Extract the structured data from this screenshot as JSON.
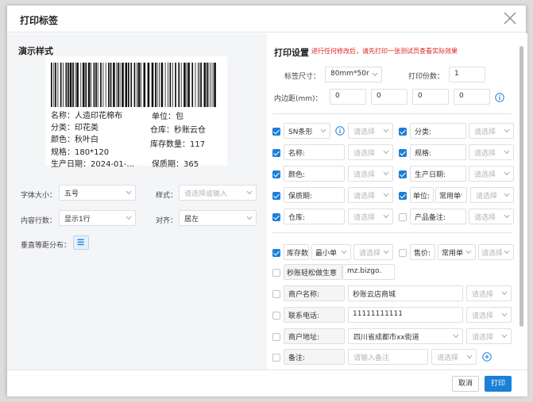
{
  "dialog": {
    "title": "打印标签",
    "cancel": "取消",
    "print": "打印"
  },
  "preview": {
    "title": "演示样式",
    "label": {
      "name": "名称：人造印花棉布",
      "unit": "单位：包",
      "category": "分类：印花类",
      "warehouse": "仓库：秒账云仓",
      "color": "颜色：秋叶白",
      "stock": "库存数量：117",
      "spec": "规格：180*120",
      "date": "生产日期：2024-01-...",
      "shelf": "保质期：365"
    },
    "font_size_label": "字体大小：",
    "font_size_value": "五号",
    "style_label": "样式：",
    "style_placeholder": "请选择或输入",
    "lines_label": "内容行数：",
    "lines_value": "显示1行",
    "align_label": "对齐：",
    "align_value": "居左",
    "vertical_label": "垂直等距分布："
  },
  "settings": {
    "title": "打印设置",
    "hint": "进行任何修改后，请先打印一张测试页查看实际效果",
    "size_label": "标签尺寸：",
    "size_value": "80mm*50r",
    "copies_label": "打印份数：",
    "copies_value": "1",
    "padding_label": "内边距(mm)：",
    "padding_values": [
      "0",
      "0",
      "0",
      "0"
    ],
    "select_placeholder": "请选择",
    "note_placeholder": "请输入备注",
    "fields": {
      "sn": "SN条形",
      "category": "分类:",
      "name": "名称:",
      "spec": "规格:",
      "color": "颜色:",
      "date": "生产日期:",
      "shelf": "保质期:",
      "unit": "单位:",
      "unit_value": "常用单",
      "warehouse": "仓库:",
      "product_note": "产品备注:",
      "stock": "库存数",
      "stock_value": "最小单",
      "price": "售价:",
      "price_value": "常用单",
      "promo": "秒账轻松做生意",
      "promo_value": "mz.bizgo.",
      "shop_name": "商户名称:",
      "shop_name_value": "秒账云店商城",
      "phone": "联系电话:",
      "phone_value": "11111111111",
      "address": "商户地址:",
      "address_value": "四川省成都市xx街道",
      "note": "备注:"
    }
  },
  "colors": {
    "accent": "#1c7fd8",
    "hint": "#e02020"
  }
}
